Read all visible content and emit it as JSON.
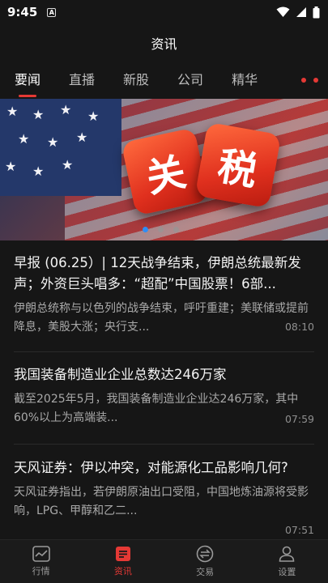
{
  "status": {
    "time": "9:45",
    "notif": "A"
  },
  "header": {
    "title": "资讯"
  },
  "tabs": [
    "要闻",
    "直播",
    "新股",
    "公司",
    "精华"
  ],
  "banner": {
    "text1": "关",
    "text2": "税"
  },
  "news": [
    {
      "title": "早报 (06.25）| 12天战争结束，伊朗总统最新发声；外资巨头唱多：“超配”中国股票！6部...",
      "summary": "伊朗总统称与以色列的战争结束，呼吁重建；美联储或提前降息，美股大涨；央行支...",
      "time": "08:10"
    },
    {
      "title": "我国装备制造业企业总数达246万家",
      "summary": "截至2025年5月，我国装备制造业企业达246万家，其中60%以上为高端装...",
      "time": "07:59"
    },
    {
      "title": "天风证券：伊以冲突，对能源化工品影响几何?",
      "summary": "天风证券指出，若伊朗原油出口受阻，中国地炼油源将受影响，LPG、甲醇和乙二...",
      "time": "07:51"
    }
  ],
  "bottom_nav": [
    "行情",
    "资讯",
    "交易",
    "设置"
  ],
  "colors": {
    "accent": "#e53935",
    "background": "#161616",
    "carousel_dot": "#2f8df5"
  }
}
